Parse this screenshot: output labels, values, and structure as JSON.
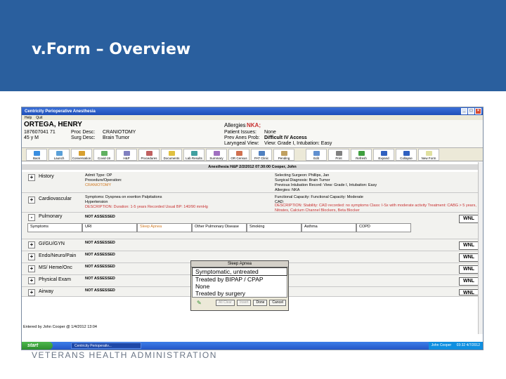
{
  "slide": {
    "title": "v.Form – Overview",
    "footer": "VETERANS HEALTH ADMINISTRATION",
    "colors": {
      "banner": "#2a5f9e",
      "wnl_border": "#606060",
      "red_text": "#c83030"
    }
  },
  "app": {
    "window_title": "Centricity Perioperative Anesthesia",
    "menu": [
      "Help",
      "Quit"
    ],
    "patient": {
      "name": "ORTEGA, HENRY",
      "id": "187607041 71",
      "age_sex": "45 y M",
      "proc_label": "Proc Desc:",
      "proc": "CRANIOTOMY",
      "surg_label": "Surg Desc:",
      "surg": "Brain Tumor",
      "allergies_label": "Allergies",
      "allergies_value": "NKA;",
      "patient_issues_label": "Patient Issues:",
      "patient_issues": "None",
      "prev_anes_label": "Prev Anes Prob:",
      "prev_anes": "Difficult IV Access",
      "laryng_label": "Laryngeal View:",
      "laryng": "View: Grade I, Intubation: Easy"
    },
    "toolbar": [
      "Back",
      "Launch",
      "Conversation",
      "Covid-19",
      "H&P",
      "Procedures",
      "Documents",
      "Lab Results",
      "Summary",
      "OR Census",
      "PAT Clinic",
      "Pending",
      "Edit",
      "Print",
      "Refresh",
      "Expand",
      "Collapse",
      "New Form"
    ],
    "section_header": "Anesthesia H&P 2/2/2012 07:30:00  Cooper, John",
    "history": {
      "label": "History",
      "admit_type": "Admit Type:  OP",
      "proc_op": "Procedure/Operation:",
      "proc_op_value": "CRANIOTOMY",
      "surgeon": "Selecting Surgeon:  Phillips, Jan",
      "surg_diag": "Surgical Diagnosis:  Brain Tumor",
      "prev_intub": "Previous Intubation Record:  View: Grade I, Intubation: Easy",
      "allergies": "Allergies:  NKA"
    },
    "cardio": {
      "label": "Cardiovascular",
      "symptoms": "Symptoms:  Dyspnea on exertion Palpitations",
      "htn": "Hypertension",
      "desc": "DESCRIPTION: Duration: 1-5 years    Recorded Usual BP: 140/90 mmHg",
      "func_cap": "Functional Capacity:  Functional Capacity: Moderate",
      "cad": "CAD:",
      "cad_desc": "DESCRIPTION: Stability: CAD recorded: no symptoms    Class: I-Sx with moderate activity    Treatment: CABG > 5 years, Nitrates, Calcium Channel Blockers, Beta Blocker"
    },
    "pulmonary": {
      "label": "Pulmonary",
      "status": "NOT ASSESSED",
      "columns": [
        "Symptoms",
        "URI",
        "Sleep Apnea",
        "Other Pulmonary Disease",
        "Smoking",
        "Asthma",
        "COPD"
      ]
    },
    "rows": [
      {
        "label": "GI/GU/GYN",
        "status": "NOT ASSESSED"
      },
      {
        "label": "Endo/Neuro/Pain",
        "status": "NOT ASSESSED"
      },
      {
        "label": "MS/ Heme/Onc",
        "status": "NOT ASSESSED"
      },
      {
        "label": "Physical Exam",
        "status": "NOT ASSESSED"
      },
      {
        "label": "Airway",
        "status": "NOT ASSESSED"
      }
    ],
    "wnl": "WNL",
    "popup": {
      "title": "Sleep Apnea",
      "options": [
        "Symptomatic, untreated",
        "Treated by BIPAP / CPAP",
        "None",
        "Treated by surgery"
      ],
      "buttons": [
        "All Clear",
        "Insert",
        "Done",
        "Cancel"
      ]
    },
    "status_line": "Entered by John Cooper @ 1/4/2012 13:04",
    "taskbar": {
      "start": "start",
      "task": "Centricity Perioperativ...",
      "user": "John Cooper",
      "clock": "03:32  4/7/2012"
    }
  }
}
